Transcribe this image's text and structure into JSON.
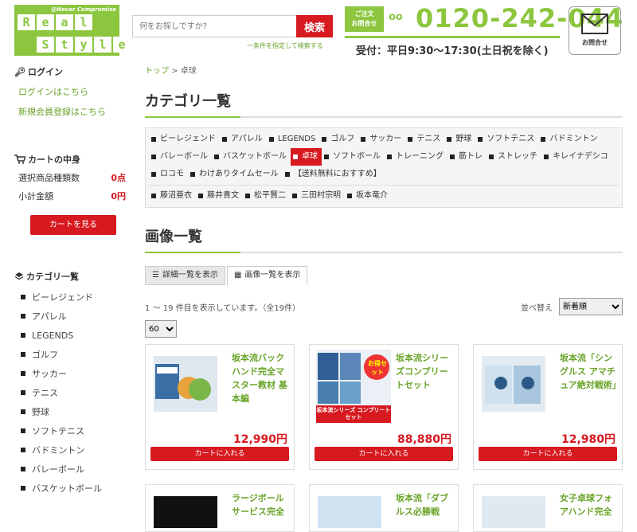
{
  "header": {
    "logo_row1": [
      "R",
      "e",
      "a",
      "l"
    ],
    "logo_row2": [
      "S",
      "t",
      "y",
      "l",
      "e"
    ],
    "logo_tag": "@Never Compromise",
    "search_placeholder": "何をお探しですか?",
    "search_button": "検索",
    "advanced_search": "一条件を指定して検索する",
    "contact_small_1": "ご注文",
    "contact_small_2": "お問合せ",
    "freedial": "oo",
    "phone": "0120-242-044",
    "hours": "受付：平日9:30〜17:30(土日祝を除く)",
    "mail_label": "お問合せ"
  },
  "sidebar": {
    "login_title": "ログイン",
    "login_link": "ログインはこちら",
    "register_link": "新規会員登録はこちら",
    "cart_title": "カートの中身",
    "cart_count_label": "選択商品種類数",
    "cart_count": "0点",
    "cart_total_label": "小計金額",
    "cart_total": "0円",
    "cart_button": "カートを見る",
    "category_title": "カテゴリ一覧",
    "categories": [
      "ビーレジェンド",
      "アパレル",
      "LEGENDS",
      "ゴルフ",
      "サッカー",
      "テニス",
      "野球",
      "ソフトテニス",
      "バドミントン",
      "バレーボール",
      "バスケットボール"
    ]
  },
  "main": {
    "breadcrumb_top": "トップ",
    "breadcrumb_sep": " > ",
    "breadcrumb_current": "卓球",
    "category_heading": "カテゴリ一覧",
    "cat_row1": [
      "ビーレジェンド",
      "アパレル",
      "LEGENDS",
      "ゴルフ",
      "サッカー",
      "テニス",
      "野球",
      "ソフトテニス",
      "バドミントン"
    ],
    "cat_row2": [
      "バレーボール",
      "バスケットボール",
      "卓球",
      "ソフトボール",
      "トレーニング",
      "筋トレ",
      "ストレッチ",
      "キレイナデシコ"
    ],
    "cat_row3": [
      "ロコモ",
      "わけありタイムセール",
      "【送料無料におすすめ】"
    ],
    "cat_row4": [
      "藤沼亜衣",
      "藤井貴文",
      "松平賢二",
      "三田村宗明",
      "坂本竜介"
    ],
    "active_category": "卓球",
    "image_heading": "画像一覧",
    "tab_detail": "詳細一覧を表示",
    "tab_image": "画像一覧を表示",
    "result_text": "1 ～ 19 件目を表示しています。（全19件）",
    "sort_label": "並べ替え",
    "sort_value": "新着順",
    "perpage": "60",
    "add_to_cart": "カートに入れる"
  },
  "products": [
    {
      "name": "坂本流バックハンド完全マスター教材 基本編",
      "price": "12,990円"
    },
    {
      "name": "坂本流シリーズコンプリートセット",
      "price": "88,880円",
      "badge": "お得セット",
      "banner": "坂本流シリーズ コンプリートセット"
    },
    {
      "name": "坂本流「シングルス アマチュア絶対戦術」",
      "price": "12,980円"
    },
    {
      "name": "ラージボールサービス完全",
      "price": ""
    },
    {
      "name": "坂本流「ダブルス必勝戦",
      "price": ""
    },
    {
      "name": "女子卓球フォアハンド完全",
      "price": ""
    }
  ],
  "colors": {
    "accent_green": "#8cc63f",
    "link_green": "#6aa329",
    "brand_red": "#d71920"
  }
}
